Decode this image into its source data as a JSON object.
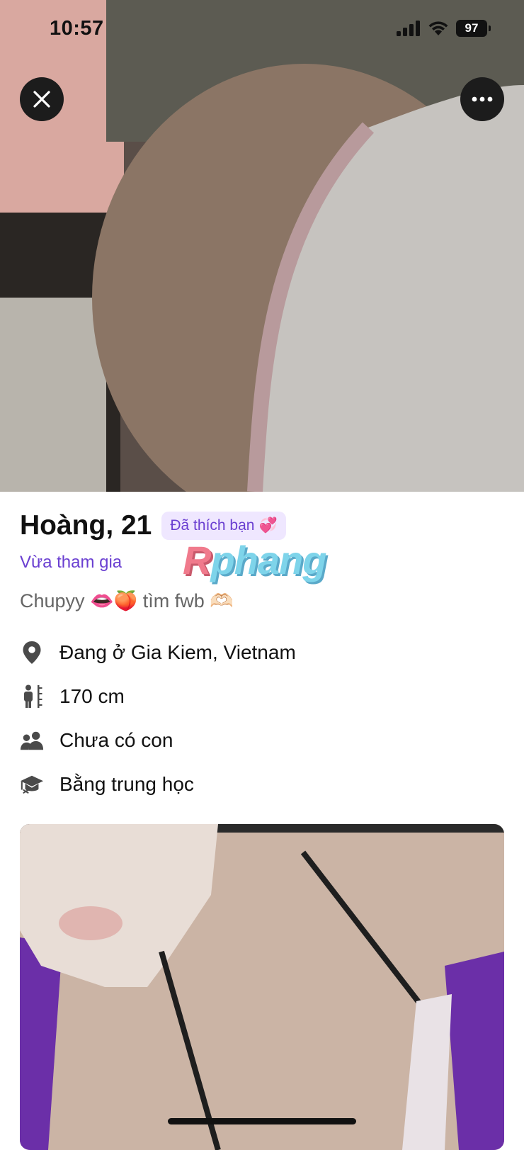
{
  "status_bar": {
    "time": "10:57",
    "battery": "97"
  },
  "profile": {
    "name_age": "Hoàng, 21",
    "liked_badge": "Đã thích bạn",
    "liked_badge_emoji": "💞",
    "joined_status": "Vừa tham gia",
    "bio": "Chupyy 👄🍑 tìm fwb 🫶🏻",
    "details": [
      {
        "icon": "location-pin-icon",
        "text": "Đang ở Gia Kiem, Vietnam"
      },
      {
        "icon": "height-icon",
        "text": "170 cm"
      },
      {
        "icon": "people-icon",
        "text": "Chưa có con"
      },
      {
        "icon": "graduation-cap-icon",
        "text": "Bằng trung học"
      }
    ]
  },
  "watermark": {
    "first": "R",
    "rest": "phang"
  },
  "colors": {
    "accent": "#6a3fd1",
    "badge_bg": "#efe7ff",
    "button_bg": "#1c1c1c"
  }
}
